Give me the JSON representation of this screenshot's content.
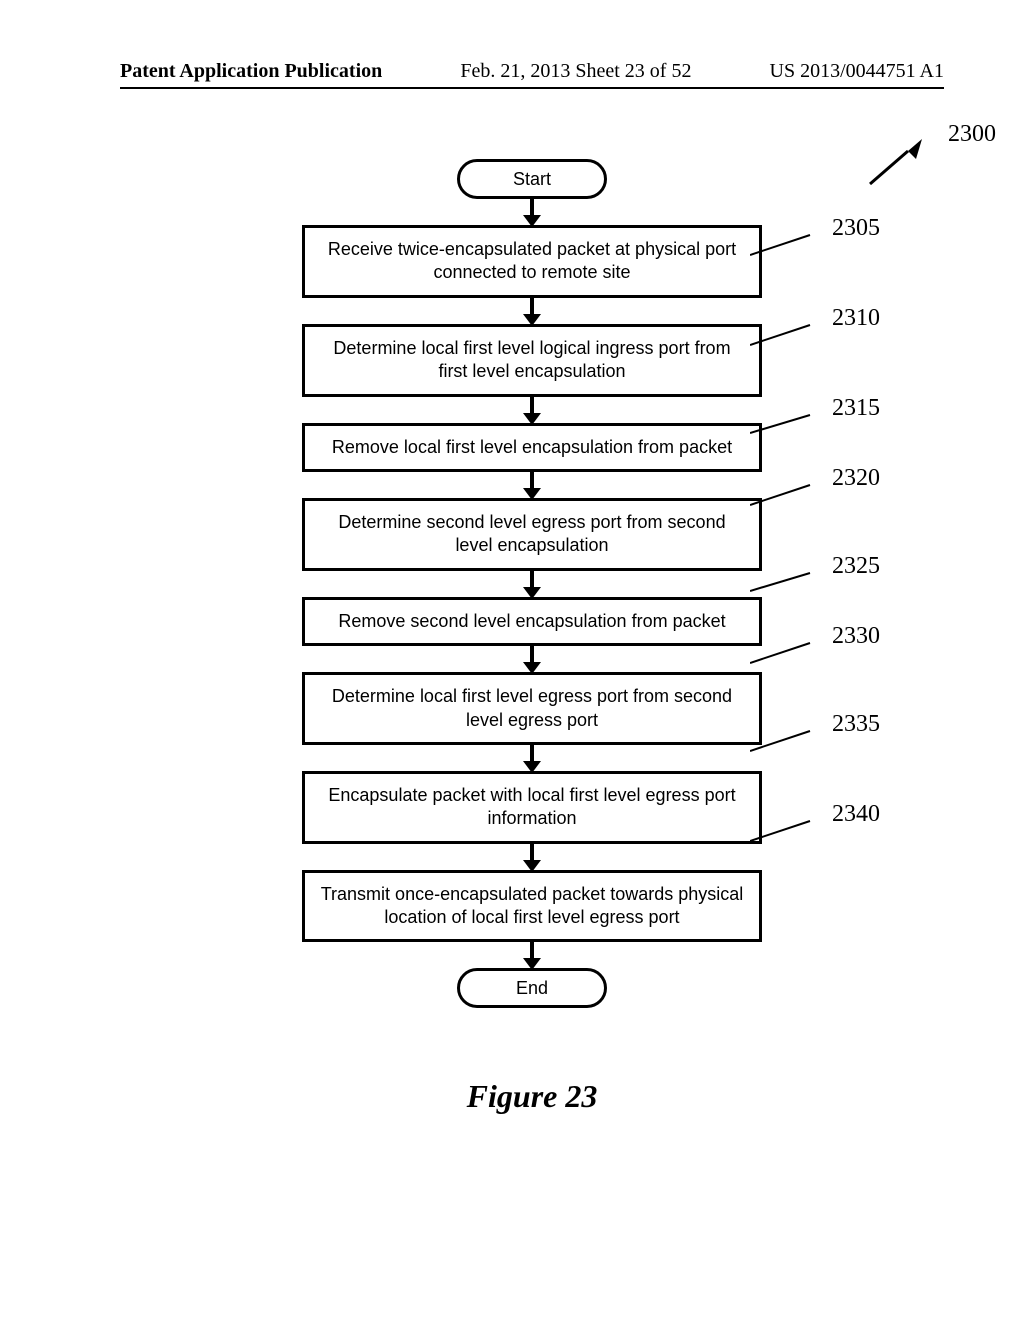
{
  "header": {
    "left": "Patent Application Publication",
    "center": "Feb. 21, 2013  Sheet 23 of 52",
    "right": "US 2013/0044751 A1"
  },
  "flowchart": {
    "start": "Start",
    "end": "End",
    "steps": [
      "Receive twice-encapsulated packet at physical port connected to remote site",
      "Determine local first level logical ingress port from first level encapsulation",
      "Remove local first level encapsulation from packet",
      "Determine second level egress port from second level encapsulation",
      "Remove second level encapsulation from packet",
      "Determine local first level egress port from second level egress port",
      "Encapsulate packet with local first level egress port information",
      "Transmit once-encapsulated packet towards physical location of local first level egress port"
    ],
    "ref_main": "2300",
    "refs": [
      "2305",
      "2310",
      "2315",
      "2320",
      "2325",
      "2330",
      "2335",
      "2340"
    ]
  },
  "figure_label": "Figure 23"
}
